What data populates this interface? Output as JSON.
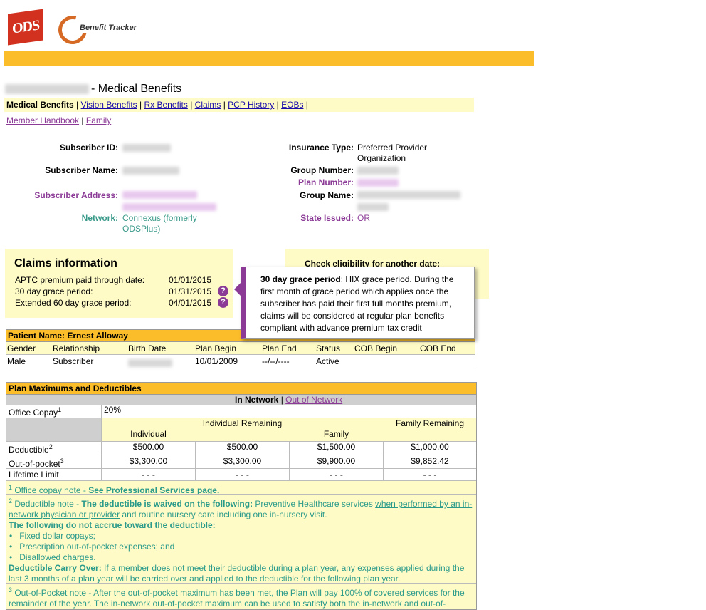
{
  "header": {
    "ods_logo_text": "ODS",
    "benefit_tracker_text": "Benefit Tracker"
  },
  "page": {
    "title": "- Medical Benefits"
  },
  "nav": {
    "items": [
      "Medical Benefits",
      "Vision Benefits",
      "Rx Benefits",
      "Claims",
      "PCP History",
      "EOBs"
    ],
    "separator": "|",
    "secondary": [
      "Member Handbook",
      "Family"
    ]
  },
  "subscriber": {
    "id_label": "Subscriber ID:",
    "name_label": "Subscriber Name:",
    "address_label": "Subscriber Address:",
    "network_label": "Network:",
    "network_value": "Connexus (formerly ODSPlus)",
    "insurance_type_label": "Insurance Type:",
    "insurance_type_value": "Preferred Provider Organization",
    "group_number_label": "Group Number:",
    "plan_number_label": "Plan Number:",
    "group_name_label": "Group Name:",
    "state_issued_label": "State Issued:",
    "state_issued_value": "OR"
  },
  "claims": {
    "title": "Claims information",
    "rows": [
      {
        "label": "APTC premium paid through date:",
        "date": "01/01/2015"
      },
      {
        "label": "30 day grace period:",
        "date": "01/31/2015"
      },
      {
        "label": "Extended 60 day grace period:",
        "date": "04/01/2015"
      }
    ],
    "help_glyph": "?"
  },
  "eligibility": {
    "title": "Check eligibility for another date:"
  },
  "tooltip": {
    "term": "30 day grace period",
    "text": ": HIX grace period. During the first month of grace period which applies once the subscriber has paid their first full months premium, claims will be considered at regular plan benefits compliant with advance premium tax credit"
  },
  "patient": {
    "title": "Patient Name: Ernest Alloway",
    "columns": [
      "Gender",
      "Relationship",
      "Birth Date",
      "Plan Begin",
      "Plan End",
      "Status",
      "COB Begin",
      "COB End"
    ],
    "row": {
      "gender": "Male",
      "relationship": "Subscriber",
      "plan_begin": "10/01/2009",
      "plan_end": "--/--/----",
      "status": "Active"
    }
  },
  "plan_max": {
    "title": "Plan Maximums and Deductibles",
    "in_network": "In Network",
    "sep": "|",
    "out_of_network": "Out of Network",
    "office_copay_label": "Office Copay",
    "office_copay_value": "20%",
    "col_headers": [
      "Individual",
      "Individual Remaining",
      "Family",
      "Family Remaining"
    ],
    "rows": [
      {
        "label": "Deductible",
        "sup": "2",
        "values": [
          "$500.00",
          "$500.00",
          "$1,500.00",
          "$1,000.00"
        ]
      },
      {
        "label": "Out-of-pocket",
        "sup": "3",
        "values": [
          "$3,300.00",
          "$3,300.00",
          "$9,900.00",
          "$9,852.42"
        ]
      },
      {
        "label": "Lifetime Limit",
        "sup": "",
        "values": [
          "- - -",
          "- - -",
          "- - -",
          "- - -"
        ]
      }
    ],
    "note1": {
      "sup": "1",
      "text": " Office copay note - ",
      "bold": "See Professional Services page."
    },
    "note2": {
      "sup": "2",
      "intro": " Deductible note - ",
      "bold": "The deductible is waived on the following:",
      "text1": " Preventive Healthcare services ",
      "underline": "when performed by an in-network physician or provider",
      "text2": " and routine nursery care including one in-nursery visit.",
      "not_accrue": "The following do not accrue toward the deductible:",
      "bullets": [
        "Fixed dollar copays;",
        "Prescription out-of-pocket expenses; and",
        "Disallowed charges."
      ],
      "carry_bold": "Deductible Carry Over:",
      "carry_text": " If a member does not meet their deductible during a plan year, any expenses applied during the last 3 months of a plan year will be carried over and applied to the deductible for the following plan year."
    },
    "note3": {
      "sup": "3",
      "text": " Out-of-Pocket note - After the out-of-pocket maximum has been met, the Plan will pay 100% of covered services for the remainder of the year. The in-network out-of-pocket maximum can be used to satisfy both the in-network and out-of-"
    }
  }
}
